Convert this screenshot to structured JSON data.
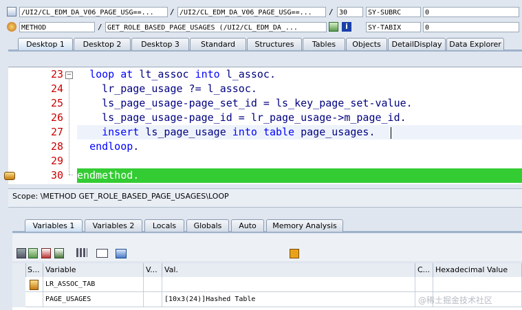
{
  "header": {
    "row1": {
      "program": "/UI2/CL_EDM_DA_V06_PAGE_USG==...",
      "include": "/UI2/CL_EDM_DA_V06_PAGE_USG==...",
      "line": "30",
      "sysvar_name": "SY-SUBRC",
      "sysvar_value": "0",
      "sep": "/"
    },
    "row2": {
      "event_type": "METHOD",
      "event_name": "GET_ROLE_BASED_PAGE_USAGES (/UI2/CL_EDM_DA_...",
      "sysvar_name": "SY-TABIX",
      "sysvar_value": "0",
      "sep": "/"
    }
  },
  "desktop_tabs": [
    "Desktop 1",
    "Desktop 2",
    "Desktop 3",
    "Standard",
    "Structures",
    "Tables",
    "Objects",
    "DetailDisplay",
    "Data Explorer"
  ],
  "code": {
    "lines": [
      {
        "no": "23",
        "text": "loop at lt_assoc into l_assoc."
      },
      {
        "no": "24",
        "text": "  lr_page_usage ?= l_assoc."
      },
      {
        "no": "25",
        "text": "  ls_page_usage-page_set_id = ls_key_page_set-value."
      },
      {
        "no": "26",
        "text": "  ls_page_usage-page_id = lr_page_usage->m_page_id."
      },
      {
        "no": "27",
        "text": "  insert ls_page_usage into table page_usages."
      },
      {
        "no": "28",
        "text": "endloop."
      },
      {
        "no": "29",
        "text": ""
      },
      {
        "no": "30",
        "text": "endmethod."
      }
    ],
    "collapse_marker": "−"
  },
  "scope": "Scope: \\METHOD GET_ROLE_BASED_PAGE_USAGES\\LOOP",
  "variable_tabs": [
    "Variables 1",
    "Variables 2",
    "Locals",
    "Globals",
    "Auto",
    "Memory Analysis"
  ],
  "toolbar_icons": [
    "delete-icon",
    "insert-icon",
    "save-icon",
    "layout-icon",
    "hierarchy-icon",
    "navigate-icon",
    "find-icon",
    "save-disk-icon"
  ],
  "table": {
    "headers": [
      "S...",
      "Variable",
      "V...",
      "Val.",
      "C...",
      "Hexadecimal Value"
    ],
    "rows": [
      {
        "variable": "LR_ASSOC_TAB",
        "value": ""
      },
      {
        "variable": "PAGE_USAGES",
        "value": "[10x3(24)]Hashed Table"
      }
    ]
  },
  "watermark": "@稀土掘金技术社区",
  "colors": {
    "current_line": "#33cc33",
    "accent": "#0000ff",
    "line_number": "#cc0000"
  }
}
